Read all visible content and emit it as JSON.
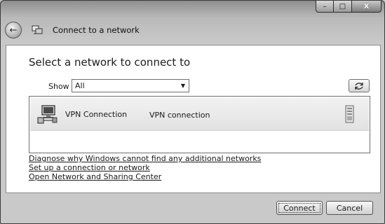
{
  "window": {
    "title": "Connect to a network",
    "caption": {
      "minimize": "–",
      "maximize": "□",
      "close": "X"
    },
    "back_icon": "back-arrow-icon"
  },
  "main": {
    "heading": "Select a network to connect to",
    "show": {
      "label": "Show",
      "selected": "All"
    },
    "networks": [
      {
        "name": "VPN Connection",
        "type": "VPN connection",
        "icon": "vpn-connection-icon",
        "status_icon": "server-icon"
      }
    ],
    "links": [
      "Diagnose why Windows cannot find any additional networks",
      "Set up a connection or network",
      "Open Network and Sharing Center"
    ]
  },
  "buttons": {
    "connect": "Connect",
    "cancel": "Cancel"
  }
}
